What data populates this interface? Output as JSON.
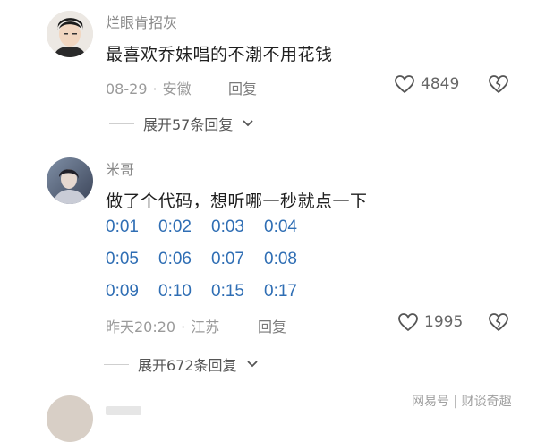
{
  "comments": [
    {
      "username": "烂眼肯招灰",
      "content": "最喜欢乔妹唱的不潮不用花钱",
      "date": "08-29",
      "location": "安徽",
      "reply_label": "回复",
      "likes": "4849",
      "expand_label": "展开57条回复"
    },
    {
      "username": "米哥",
      "content": "做了个代码，想听哪一秒就点一下",
      "timestamps": [
        [
          "0:01",
          "0:02",
          "0:03",
          "0:04"
        ],
        [
          "0:05",
          "0:06",
          "0:07",
          "0:08"
        ],
        [
          "0:09",
          "0:10",
          "0:15",
          "0:17"
        ]
      ],
      "date": "昨天20:20",
      "location": "江苏",
      "reply_label": "回复",
      "likes": "1995",
      "expand_label": "展开672条回复"
    }
  ],
  "watermark": "网易号 | 财谈奇趣",
  "colors": {
    "timestamp": "#2f6eb4",
    "meta": "#9a9a9a"
  }
}
